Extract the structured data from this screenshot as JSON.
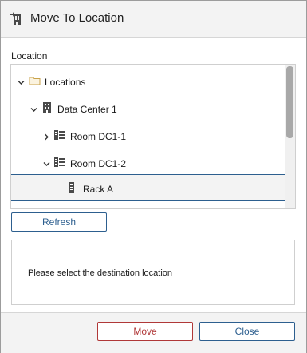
{
  "dialog": {
    "title": "Move To Location",
    "title_icon": "building-move-icon"
  },
  "location": {
    "label": "Location",
    "tree": [
      {
        "label": "Locations",
        "icon": "folder-icon",
        "expanded": true,
        "chevron": "chevron-down-icon"
      },
      {
        "label": "Data Center 1",
        "icon": "building-icon",
        "expanded": true,
        "chevron": "chevron-down-icon"
      },
      {
        "label": "Room DC1-1",
        "icon": "room-icon",
        "expanded": false,
        "chevron": "chevron-right-icon"
      },
      {
        "label": "Room DC1-2",
        "icon": "room-icon",
        "expanded": true,
        "chevron": "chevron-down-icon"
      },
      {
        "label": "Rack A",
        "icon": "rack-icon",
        "selected": true
      }
    ]
  },
  "refresh_label": "Refresh",
  "message": "Please select the destination location",
  "footer": {
    "move_label": "Move",
    "close_label": "Close"
  },
  "colors": {
    "accent": "#2d5f8f",
    "danger": "#b03838",
    "folder": "#c8a24a"
  }
}
